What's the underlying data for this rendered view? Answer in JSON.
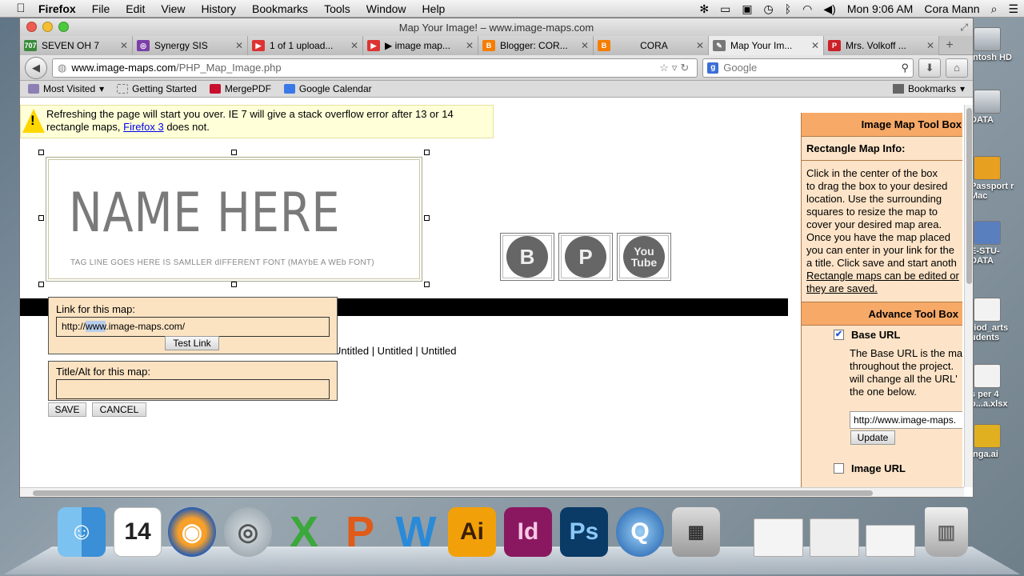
{
  "menubar": {
    "app": "Firefox",
    "items": [
      "File",
      "Edit",
      "View",
      "History",
      "Bookmarks",
      "Tools",
      "Window",
      "Help"
    ],
    "clock": "Mon 9:06 AM",
    "user": "Cora Mann"
  },
  "window": {
    "title": "Map Your Image! – www.image-maps.com"
  },
  "tabs": [
    {
      "label": "SEVEN OH 7",
      "fav": "707",
      "color": "#3a8a3a"
    },
    {
      "label": "Synergy SIS",
      "fav": "◎",
      "color": "#7a3fa8"
    },
    {
      "label": "1 of 1 upload...",
      "fav": "▶",
      "color": "#d33"
    },
    {
      "label": "▶ image map...",
      "fav": "▶",
      "color": "#d33"
    },
    {
      "label": "Blogger: COR...",
      "fav": "B",
      "color": "#f57d00"
    },
    {
      "label": "CORA",
      "fav": "B",
      "color": "#f57d00"
    },
    {
      "label": "Map Your Im...",
      "fav": "✎",
      "color": "#777"
    },
    {
      "label": "Mrs. Volkoff ...",
      "fav": "P",
      "color": "#cb2027"
    }
  ],
  "nav": {
    "url_host": "www.image-maps.com",
    "url_path": "/PHP_Map_Image.php",
    "search_placeholder": "Google"
  },
  "bookmarks": {
    "items": [
      "Most Visited",
      "Getting Started",
      "MergePDF",
      "Google Calendar"
    ],
    "right": "Bookmarks"
  },
  "page": {
    "warning_text": "Refreshing the page will start you over. IE 7 will give a stack overflow error after 13 or 14 rectangle maps,",
    "warning_link": "Firefox 3",
    "warning_tail": "does not.",
    "image_title": "NAME HERE",
    "image_tagline": "TAG LINE GOES HERE IS SAMLLER dIFFERENT FONT (MAYbE A WEb FONT)",
    "social": [
      "B",
      "P",
      "You\nTube"
    ],
    "link_label": "Link for this map:",
    "link_value_pre": "http://",
    "link_value_sel": "www",
    "link_value_post": ".image-maps.com/",
    "test_link": "Test Link",
    "title_label": "Title/Alt for this map:",
    "title_value": "",
    "untitled_list": "Untitled | Untitled | Untitled",
    "save": "SAVE",
    "cancel": "CANCEL"
  },
  "toolbox": {
    "header": "Image Map Tool Box",
    "sub": "Rectangle Map Info:",
    "info_lines": [
      "Click in the center of the box",
      "to drag the box to your desired",
      "location. Use the surrounding",
      "squares to resize the map to",
      "cover your desired map area.",
      "Once you have the map placed",
      "you can enter in your link for the",
      "a title. Click save and start anoth"
    ],
    "info_link_1": "Rectangle maps can be edited or",
    "info_link_2": "they are saved.",
    "advance_header": "Advance Tool Box",
    "base_url_label": "Base URL",
    "base_url_checked": true,
    "base_desc": [
      "The Base URL is the ma",
      "throughout the project.",
      "will change all the URL'",
      "the one below."
    ],
    "base_url_value": "http://www.image-maps.",
    "update": "Update",
    "image_url_label": "Image URL"
  },
  "desktop_icons": [
    "intosh HD",
    "DATA",
    "Passport r Mac",
    "E-STU- DATA",
    "riod_arts udents",
    "s per 4 o...a.xlsx",
    "inga.ai"
  ],
  "dock": [
    "Finder",
    "14",
    "Firefox",
    "Grab",
    "X",
    "P",
    "W",
    "Ai",
    "Id",
    "Ps",
    "QuickTime",
    "Preview"
  ]
}
